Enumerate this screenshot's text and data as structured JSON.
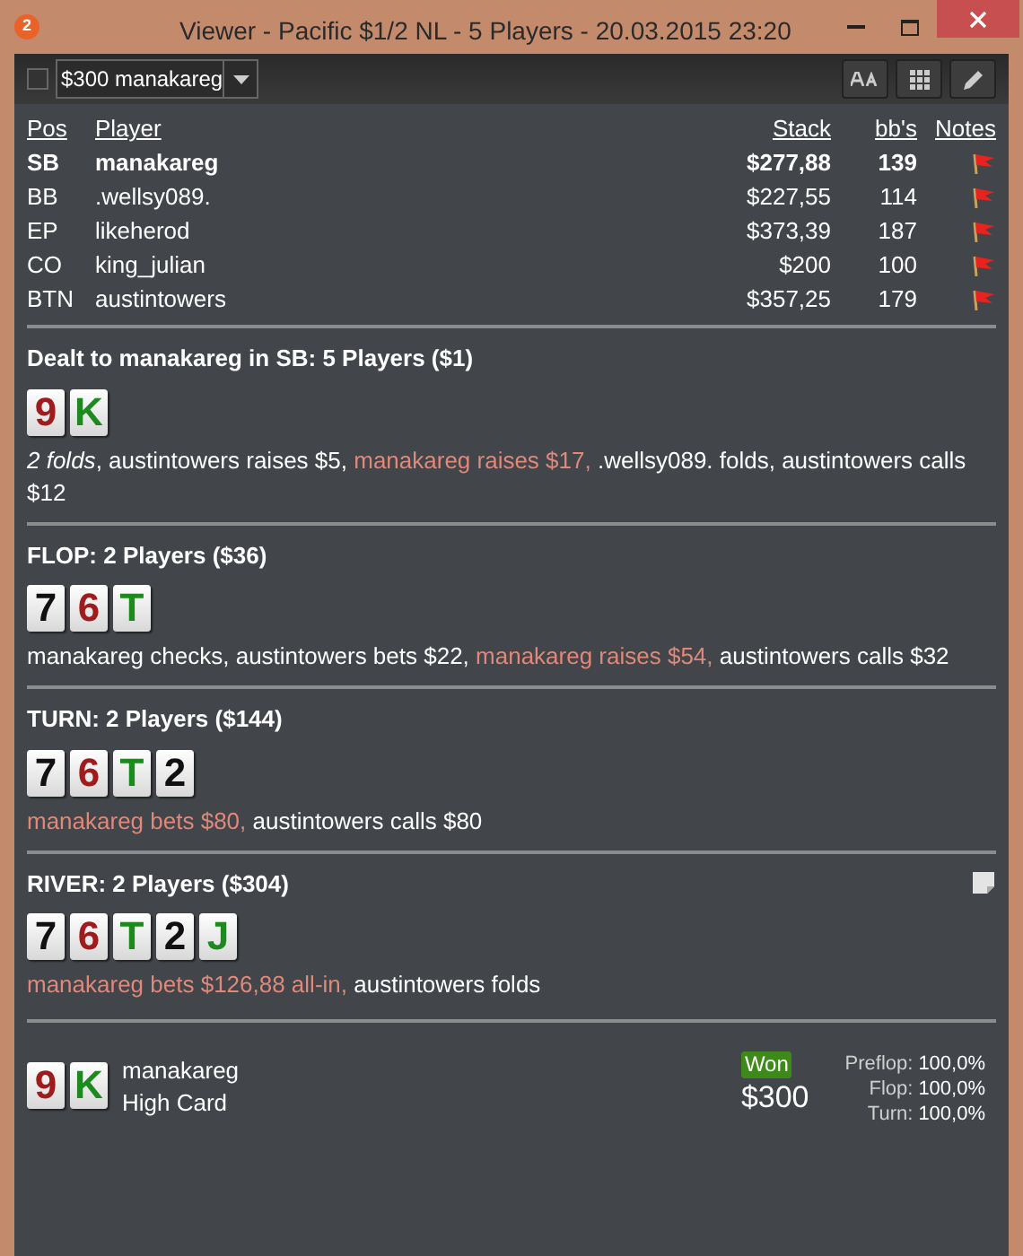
{
  "window": {
    "title": "Viewer - Pacific $1/2 NL - 5 Players - 20.03.2015 23:20",
    "badge": "2"
  },
  "toolbar": {
    "checked": false,
    "hand_select": {
      "value": "$300 manakareg"
    }
  },
  "players": {
    "columns": [
      "Pos",
      "Player",
      "Stack",
      "bb's",
      "Notes"
    ],
    "rows": [
      {
        "pos": "SB",
        "name": "manakareg",
        "stack": "$277,88",
        "bbs": "139",
        "hero": true
      },
      {
        "pos": "BB",
        "name": ".wellsy089.",
        "stack": "$227,55",
        "bbs": "114",
        "hero": false
      },
      {
        "pos": "EP",
        "name": "likeherod",
        "stack": "$373,39",
        "bbs": "187",
        "hero": false
      },
      {
        "pos": "CO",
        "name": "king_julian",
        "stack": "$200",
        "bbs": "100",
        "hero": false
      },
      {
        "pos": "BTN",
        "name": "austintowers",
        "stack": "$357,25",
        "bbs": "179",
        "hero": false
      }
    ]
  },
  "streets": [
    {
      "title": "Dealt to manakareg in SB: 5 Players ($1)",
      "has_note": false,
      "cards": [
        {
          "rank": "9",
          "color": "#a01c1c"
        },
        {
          "rank": "K",
          "color": "#1d8a1d"
        }
      ],
      "actions": [
        {
          "text": "2 folds",
          "kind": "italic"
        },
        {
          "text": ", austintowers raises $5, ",
          "kind": "normal"
        },
        {
          "text": "manakareg raises $17,",
          "kind": "hero"
        },
        {
          "text": " .wellsy089. folds, austintowers calls $12",
          "kind": "normal"
        }
      ]
    },
    {
      "title": "FLOP: 2 Players ($36)",
      "has_note": false,
      "cards": [
        {
          "rank": "7",
          "color": "#111111"
        },
        {
          "rank": "6",
          "color": "#a01c1c"
        },
        {
          "rank": "T",
          "color": "#1d8a1d"
        }
      ],
      "actions": [
        {
          "text": "manakareg checks, austintowers bets $22, ",
          "kind": "normal"
        },
        {
          "text": "manakareg raises $54,",
          "kind": "hero"
        },
        {
          "text": " austintowers calls $32",
          "kind": "normal"
        }
      ]
    },
    {
      "title": "TURN: 2 Players ($144)",
      "has_note": false,
      "cards": [
        {
          "rank": "7",
          "color": "#111111"
        },
        {
          "rank": "6",
          "color": "#a01c1c"
        },
        {
          "rank": "T",
          "color": "#1d8a1d"
        },
        {
          "rank": "2",
          "color": "#111111"
        }
      ],
      "actions": [
        {
          "text": "manakareg bets $80,",
          "kind": "hero"
        },
        {
          "text": " austintowers calls $80",
          "kind": "normal"
        }
      ]
    },
    {
      "title": "RIVER: 2 Players ($304)",
      "has_note": true,
      "cards": [
        {
          "rank": "7",
          "color": "#111111"
        },
        {
          "rank": "6",
          "color": "#a01c1c"
        },
        {
          "rank": "T",
          "color": "#1d8a1d"
        },
        {
          "rank": "2",
          "color": "#111111"
        },
        {
          "rank": "J",
          "color": "#1d8a1d"
        }
      ],
      "actions": [
        {
          "text": "manakareg bets $126,88 all-in,",
          "kind": "hero"
        },
        {
          "text": " austintowers folds",
          "kind": "normal"
        }
      ]
    }
  ],
  "result": {
    "cards": [
      {
        "rank": "9",
        "color": "#a01c1c"
      },
      {
        "rank": "K",
        "color": "#1d8a1d"
      }
    ],
    "player": "manakareg",
    "hand": "High Card",
    "badge": "Won",
    "amount": "$300",
    "equity": [
      {
        "label": "Preflop:",
        "value": "100,0%"
      },
      {
        "label": "Flop:",
        "value": "100,0%"
      },
      {
        "label": "Turn:",
        "value": "100,0%"
      }
    ]
  }
}
